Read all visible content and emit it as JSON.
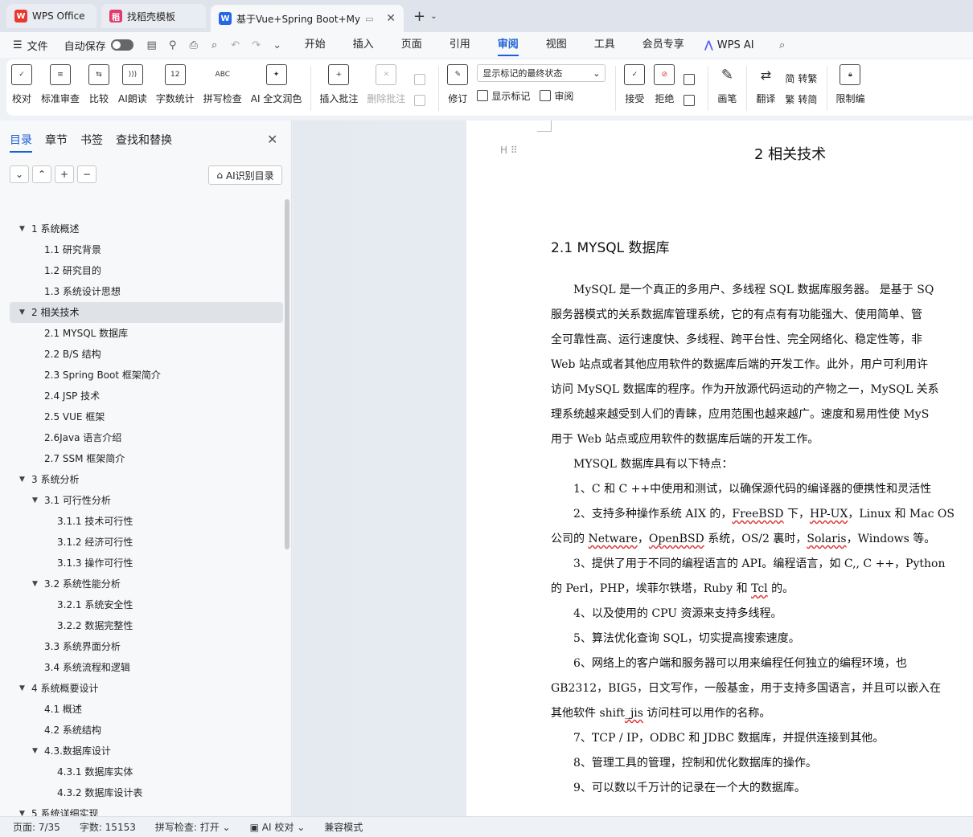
{
  "tabs": {
    "wps_office": "WPS Office",
    "templates": "找稻壳模板",
    "document": "基于Vue+Spring Boot+My",
    "close_glyph": "✕",
    "add_glyph": "+",
    "more_glyph": "⌄"
  },
  "menu": {
    "file": "文件",
    "autosave": "自动保存",
    "tabs": [
      "开始",
      "插入",
      "页面",
      "引用",
      "审阅",
      "视图",
      "工具",
      "会员专享"
    ],
    "active_tab": "审阅",
    "wps_ai": "WPS AI"
  },
  "ribbon": {
    "proofread": "校对",
    "standard_review": "标准审查",
    "compare": "比较",
    "ai_read": "AI朗读",
    "word_count": "字数统计",
    "spell_check": "拼写检查",
    "ai_polish": "AI 全文润色",
    "insert_comment": "插入批注",
    "delete_comment": "删除批注",
    "track_changes": "修订",
    "markup_state": "显示标记的最终状态",
    "show_markup": "显示标记",
    "review_pane": "审阅",
    "accept": "接受",
    "reject": "拒绝",
    "pen": "画笔",
    "translate": "翻译",
    "to_traditional": "转繁",
    "to_simplified": "转简",
    "restrict_edit": "限制编"
  },
  "nav": {
    "tabs": [
      "目录",
      "章节",
      "书签",
      "查找和替换"
    ],
    "active_tab": "目录",
    "ai_toc": "AI识别目录",
    "tools": [
      "⌄",
      "⌃",
      "+",
      "−"
    ],
    "toc": [
      {
        "text": "1 系统概述",
        "level": 1,
        "arrow": "▼"
      },
      {
        "text": "1.1  研究背景",
        "level": 2
      },
      {
        "text": "1.2 研究目的",
        "level": 2
      },
      {
        "text": "1.3 系统设计思想",
        "level": 2
      },
      {
        "text": "2 相关技术",
        "level": 1,
        "arrow": "▼",
        "selected": true
      },
      {
        "text": "2.1 MYSQL 数据库",
        "level": 2
      },
      {
        "text": "2.2 B/S 结构",
        "level": 2
      },
      {
        "text": "2.3 Spring Boot 框架简介",
        "level": 2
      },
      {
        "text": "2.4 JSP 技术",
        "level": 2
      },
      {
        "text": "2.5 VUE 框架",
        "level": 2
      },
      {
        "text": "2.6Java 语言介绍",
        "level": 2
      },
      {
        "text": "2.7 SSM 框架简介",
        "level": 2
      },
      {
        "text": "3 系统分析",
        "level": 1,
        "arrow": "▼"
      },
      {
        "text": "3.1 可行性分析",
        "level": 2,
        "arrow": "▼"
      },
      {
        "text": "3.1.1 技术可行性",
        "level": 3
      },
      {
        "text": "3.1.2 经济可行性",
        "level": 3
      },
      {
        "text": "3.1.3 操作可行性",
        "level": 3
      },
      {
        "text": "3.2 系统性能分析",
        "level": 2,
        "arrow": "▼"
      },
      {
        "text": "3.2.1  系统安全性",
        "level": 3
      },
      {
        "text": "3.2.2  数据完整性",
        "level": 3
      },
      {
        "text": "3.3 系统界面分析",
        "level": 2
      },
      {
        "text": "3.4 系统流程和逻辑",
        "level": 2
      },
      {
        "text": "4 系统概要设计",
        "level": 1,
        "arrow": "▼"
      },
      {
        "text": "4.1 概述",
        "level": 2
      },
      {
        "text": "4.2 系统结构",
        "level": 2
      },
      {
        "text": "4.3.数据库设计",
        "level": 2,
        "arrow": "▼"
      },
      {
        "text": "4.3.1 数据库实体",
        "level": 3
      },
      {
        "text": "4.3.2 数据库设计表",
        "level": 3
      },
      {
        "text": "5 系统详细实现",
        "level": 1,
        "arrow": "▼"
      }
    ]
  },
  "document": {
    "chapter_title": "2 相关技术",
    "section_title": "2.1 MYSQL 数据库",
    "heading_marker": "H",
    "lines_block1": [
      "　　MySQL 是一个真正的多用户、多线程 SQL 数据库服务器。 是基于 SQ",
      "服务器模式的关系数据库管理系统，它的有点有有功能强大、使用简单、管",
      "全可靠性高、运行速度快、多线程、跨平台性、完全网络化、稳定性等，非",
      "Web 站点或者其他应用软件的数据库后端的开发工作。此外，用户可利用许",
      "访问 MySQL 数据库的程序。作为开放源代码运动的产物之一，MySQL 关系",
      "理系统越来越受到人们的青睐，应用范围也越来越广。速度和易用性使 MyS",
      "用于 Web 站点或应用软件的数据库后端的开发工作。",
      "　　MYSQL 数据库具有以下特点：",
      "　　1、C 和 C ++中使用和测试，以确保源代码的编译器的便携性和灵活性"
    ],
    "line_os_a": "　　2、支持多种操作系统 AIX 的，",
    "line_os_freebsd": "FreeBSD",
    "line_os_b": " 下，",
    "line_os_hpux": "HP-UX",
    "line_os_c": "，Linux 和 Mac OS",
    "line_co_a": "公司的 ",
    "line_co_netware": "Netware",
    "line_co_b": "，",
    "line_co_openbsd": "OpenBSD",
    "line_co_c": " 系统，OS/2 裏时，",
    "line_co_solaris": "Solaris",
    "line_co_d": "，Windows 等。",
    "line_api": "　　3、提供了用于不同的编程语言的 API。编程语言，如 C,, C ++，Python",
    "line_perl_a": "的 Perl，PHP，埃菲尔铁塔，Ruby 和 ",
    "line_perl_tcl": "Tcl",
    "line_perl_b": " 的。",
    "lines_block2": [
      "　　4、以及使用的 CPU 资源来支持多线程。",
      "　　5、算法优化查询 SQL，切实提高搜索速度。",
      "　　6、网络上的客户端和服务器可以用来编程任何独立的编程环境，也",
      "GB2312，BIG5，日文写作，一般基金，用于支持多国语言，并且可以嵌入在"
    ],
    "line_shift_a": "其他软件 shift",
    "line_shift_jis": "_jis",
    "line_shift_b": " 访问柱可以用作的名称。",
    "lines_block3": [
      "　　7、TCP / IP，ODBC 和 JDBC 数据库，并提供连接到其他。",
      "　　8、管理工具的管理，控制和优化数据库的操作。",
      "　　9、可以数以千万计的记录在一个大的数据库。"
    ]
  },
  "status": {
    "page": "页面: 7/35",
    "word_count": "字数: 15153",
    "spell_check": "拼写检查: 打开",
    "ai_check": "AI 校对",
    "compat_mode": "兼容模式"
  },
  "colors": {
    "accent": "#1a5fd6",
    "wps_red": "#e8382f",
    "template_pink": "#e23b6b",
    "doc_blue": "#2766e8"
  }
}
